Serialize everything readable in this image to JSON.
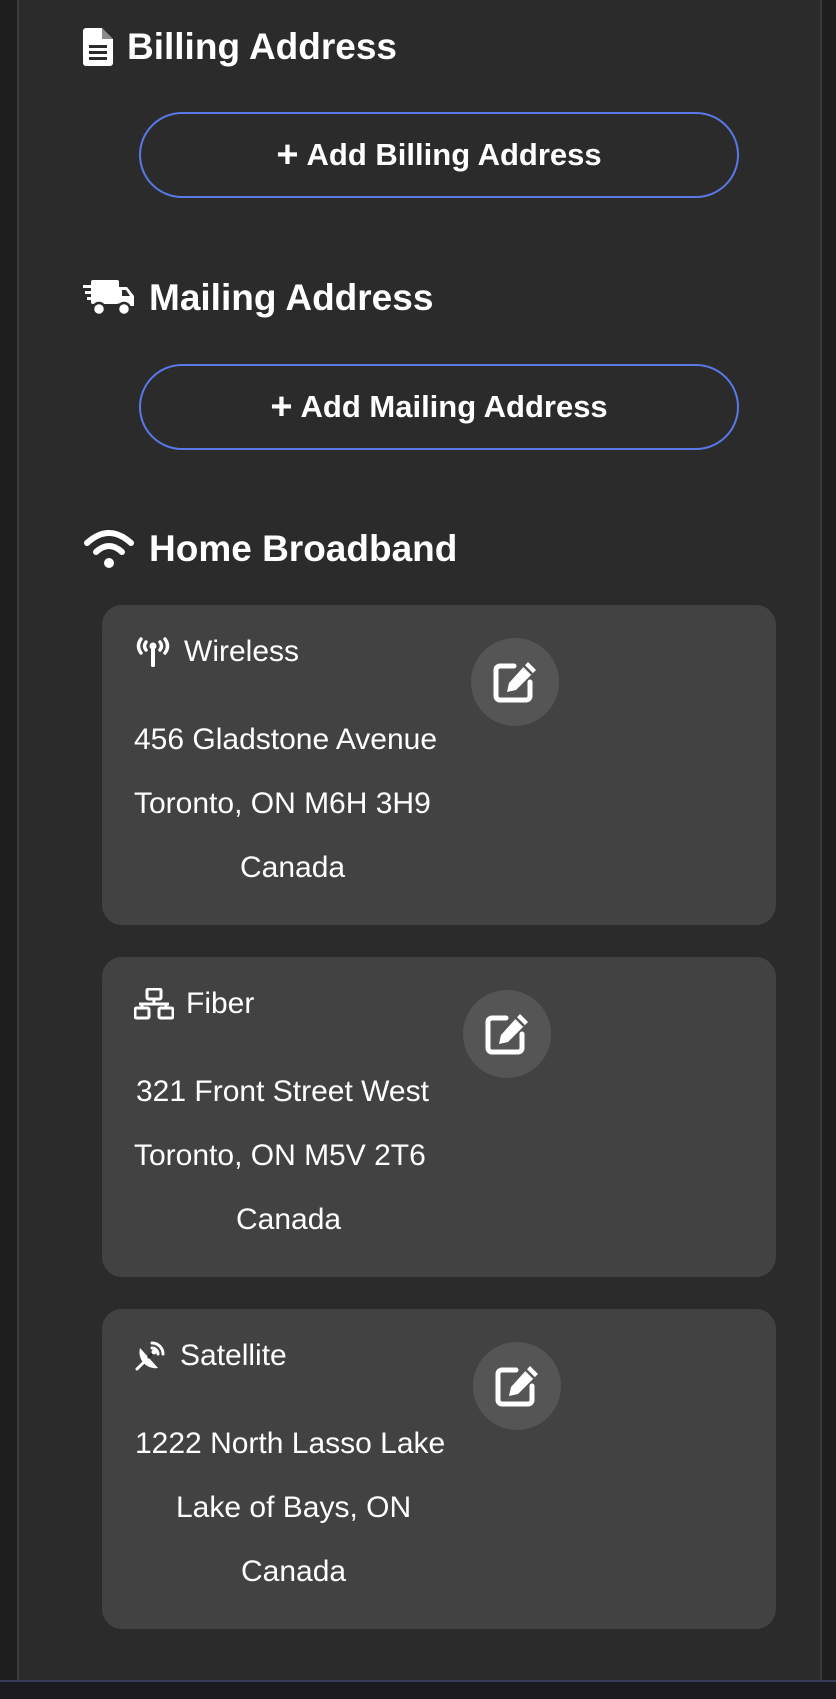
{
  "billing": {
    "title": "Billing Address",
    "icon": "file-invoice-icon",
    "add_label": "Add Billing Address"
  },
  "mailing": {
    "title": "Mailing Address",
    "icon": "truck-icon",
    "add_label": "Add Mailing Address"
  },
  "broadband": {
    "title": "Home Broadband",
    "icon": "wifi-icon",
    "services": [
      {
        "type": "Wireless",
        "icon": "tower-broadcast-icon",
        "line1": "456 Gladstone Avenue",
        "line2": "Toronto, ON M6H 3H9",
        "line3": "Canada"
      },
      {
        "type": "Fiber",
        "icon": "network-wired-icon",
        "line1": "321 Front Street West",
        "line2": "Toronto, ON M5V 2T6",
        "line3": "Canada"
      },
      {
        "type": "Satellite",
        "icon": "satellite-dish-icon",
        "line1": "1222 North Lasso Lake",
        "line2": "Lake of Bays, ON",
        "line3": "Canada"
      }
    ]
  },
  "colors": {
    "background": "#1e1e1e",
    "panel": "#2b2b2b",
    "card": "#424242",
    "button_border": "#5a78e8",
    "edit_button": "#555555",
    "text": "#ffffff"
  }
}
